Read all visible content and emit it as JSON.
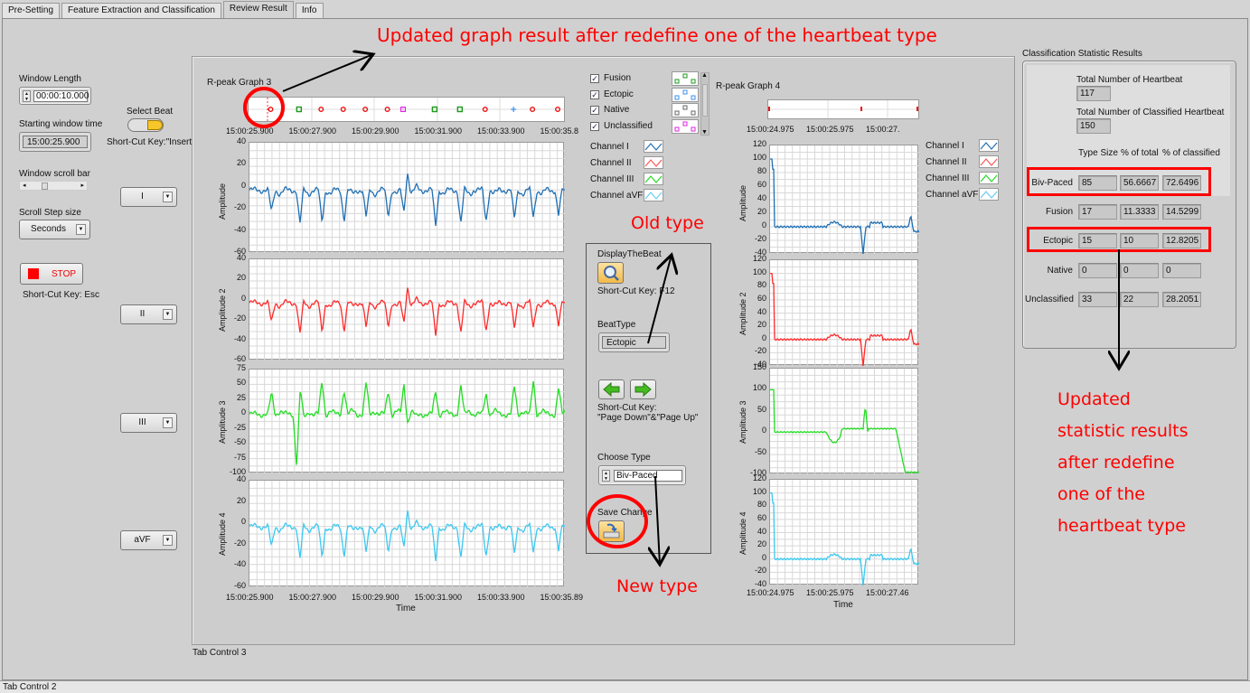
{
  "tabs": [
    "Pre-Setting",
    "Feature Extraction and Classification",
    "Review Result",
    "Info"
  ],
  "active_tab": "Review Result",
  "left": {
    "window_length_label": "Window Length",
    "window_length_value": "00:00:10.000",
    "start_time_label": "Starting window time",
    "start_time_value": "15:00:25.900",
    "scroll_bar_label": "Window scroll bar",
    "scroll_position": 0.35,
    "step_size_label": "Scroll Step size",
    "step_size_value": "Seconds",
    "stop_label": "STOP",
    "stop_shortcut": "Short-Cut Key: Esc",
    "select_beat_label": "Select Beat",
    "select_beat_shortcut": "Short-Cut Key:\"Insert\"",
    "channel_selectors": [
      "I",
      "II",
      "III",
      "aVF"
    ]
  },
  "graph3": {
    "title": "R-peak Graph 3",
    "time_ticks": [
      "15:00:25.900",
      "15:00:27.900",
      "15:00:29.900",
      "15:00:31.900",
      "15:00:33.900",
      "15:00:35.8"
    ],
    "bottom_ticks": [
      "15:00:25.900",
      "15:00:27.900",
      "15:00:29.900",
      "15:00:31.900",
      "15:00:33.900",
      "15:00:35.89"
    ],
    "xlabel": "Time",
    "markers": [
      {
        "t": 0.07,
        "type": "biv"
      },
      {
        "t": 0.16,
        "type": "fusion"
      },
      {
        "t": 0.23,
        "type": "biv"
      },
      {
        "t": 0.3,
        "type": "biv"
      },
      {
        "t": 0.37,
        "type": "biv"
      },
      {
        "t": 0.44,
        "type": "biv"
      },
      {
        "t": 0.49,
        "type": "unclassified"
      },
      {
        "t": 0.59,
        "type": "fusion"
      },
      {
        "t": 0.67,
        "type": "fusion"
      },
      {
        "t": 0.75,
        "type": "biv"
      },
      {
        "t": 0.84,
        "type": "ectopic"
      },
      {
        "t": 0.9,
        "type": "biv"
      },
      {
        "t": 0.98,
        "type": "biv"
      }
    ],
    "plots": [
      {
        "ylabel": "Amplitude",
        "ticks": [
          "40",
          "20",
          "0",
          "-20",
          "-40",
          "-60"
        ],
        "color": "#1f6fb4"
      },
      {
        "ylabel": "Amplitude 2",
        "ticks": [
          "40",
          "20",
          "0",
          "-20",
          "-40",
          "-60"
        ],
        "color": "#ff2a2a"
      },
      {
        "ylabel": "Amplitude 3",
        "ticks": [
          "75",
          "50",
          "25",
          "0",
          "-25",
          "-50",
          "-75",
          "-100"
        ],
        "color": "#22dd22"
      },
      {
        "ylabel": "Amplitude 4",
        "ticks": [
          "40",
          "20",
          "0",
          "-20",
          "-40",
          "-60"
        ],
        "color": "#3cc8f0"
      }
    ]
  },
  "beat_legend": [
    {
      "label": "Fusion",
      "checked": true,
      "color": "#1a9a1a"
    },
    {
      "label": "Ectopic",
      "checked": true,
      "color": "#3a8ff0"
    },
    {
      "label": "Native",
      "checked": true,
      "color": "#666666"
    },
    {
      "label": "Unclassified",
      "checked": true,
      "color": "#e020e0"
    }
  ],
  "channel_legend": [
    {
      "label": "Channel I",
      "color": "#1f6fb4"
    },
    {
      "label": "Channel II",
      "color": "#ff5555"
    },
    {
      "label": "Channel III",
      "color": "#22dd22"
    },
    {
      "label": "Channel aVF",
      "color": "#66ccf5"
    }
  ],
  "controls": {
    "display_beat_label": "DisplayTheBeat",
    "display_shortcut": "Short-Cut Key: F12",
    "beat_type_label": "BeatType",
    "beat_type_value": "Ectopic",
    "nav_shortcut_1": "Short-Cut Key:",
    "nav_shortcut_2": "\"Page Down\"&\"Page Up\"",
    "choose_type_label": "Choose Type",
    "choose_type_value": "Biv-Paced",
    "save_label": "Save Change"
  },
  "graph4": {
    "title": "R-peak Graph 4",
    "time_ticks": [
      "15:00:24.975",
      "15:00:25.975",
      "15:00:27."
    ],
    "bottom_ticks": [
      "15:00:24.975",
      "15:00:25.975",
      "15:00:27.46"
    ],
    "xlabel": "Time",
    "plots": [
      {
        "ylabel": "Amplitude",
        "ticks": [
          "120",
          "100",
          "80",
          "60",
          "40",
          "20",
          "0",
          "-20",
          "-40"
        ],
        "color": "#1f6fb4"
      },
      {
        "ylabel": "Amplitude 2",
        "ticks": [
          "120",
          "100",
          "80",
          "60",
          "40",
          "20",
          "0",
          "-20",
          "-40"
        ],
        "color": "#ff2a2a"
      },
      {
        "ylabel": "Amplitude 3",
        "ticks": [
          "150",
          "100",
          "50",
          "0",
          "-50",
          "-100"
        ],
        "color": "#22dd22"
      },
      {
        "ylabel": "Amplitude 4",
        "ticks": [
          "120",
          "100",
          "80",
          "60",
          "40",
          "20",
          "0",
          "-20",
          "-40"
        ],
        "color": "#3cc8f0"
      }
    ]
  },
  "stats": {
    "title": "Classification Statistic Results",
    "total_label": "Total Number of Heartbeat",
    "total_value": "117",
    "classified_label": "Total Number of Classified Heartbeat",
    "classified_value": "150",
    "columns": [
      "Type Size",
      "% of total",
      "% of classified"
    ],
    "rows": [
      {
        "type": "Biv-Paced",
        "size": "85",
        "pct_total": "56.6667",
        "pct_classified": "72.6496"
      },
      {
        "type": "Fusion",
        "size": "17",
        "pct_total": "11.3333",
        "pct_classified": "14.5299"
      },
      {
        "type": "Ectopic",
        "size": "15",
        "pct_total": "10",
        "pct_classified": "12.8205"
      },
      {
        "type": "Native",
        "size": "0",
        "pct_total": "0",
        "pct_classified": "0"
      },
      {
        "type": "Unclassified",
        "size": "33",
        "pct_total": "22",
        "pct_classified": "28.2051"
      }
    ]
  },
  "annotations": {
    "top": "Updated graph result after redefine one of the heartbeat type",
    "old_type": "Old type",
    "new_type": "New type",
    "stats_note": [
      "Updated",
      "statistic results",
      "after redefine",
      "one of the",
      "heartbeat type"
    ]
  },
  "tab_control_3": "Tab Control 3",
  "tab_control_2": "Tab Control 2"
}
